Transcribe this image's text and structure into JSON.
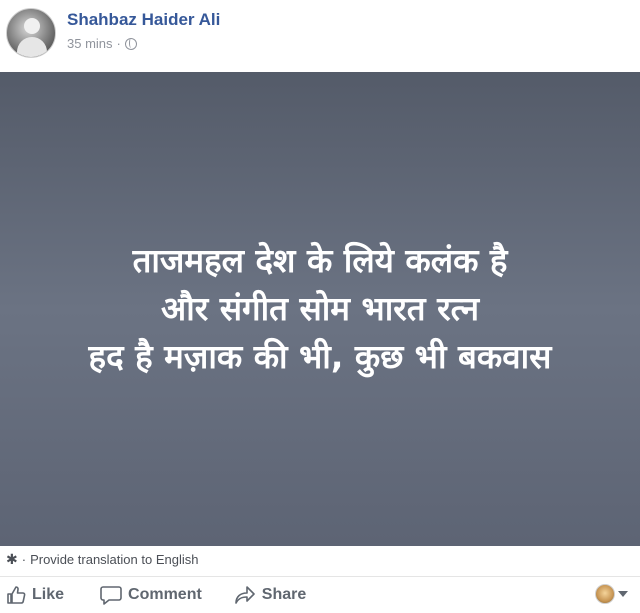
{
  "post": {
    "author": "Shahbaz Haider Ali",
    "timestamp": "35 mins",
    "separator": "·"
  },
  "image": {
    "lines": [
      "ताजमहल देश के लिये कलंक है",
      "और संगीत सोम भारत रत्न",
      "हद है मज़ाक की भी, कुछ भी बकवास"
    ]
  },
  "translation": {
    "prefix": "·",
    "link_label": "Provide translation to English"
  },
  "actions": {
    "like_label": "Like",
    "comment_label": "Comment",
    "share_label": "Share"
  },
  "icons": {
    "privacy": "globe-icon",
    "translate": "gear-icon",
    "like": "thumbs-up-icon",
    "comment": "speech-bubble-icon",
    "share": "share-arrow-icon",
    "reaction": "caret-down-icon"
  },
  "colors": {
    "author": "#365899",
    "meta": "#90949c",
    "action_text": "#606770",
    "image_bg": "#5d6474"
  }
}
